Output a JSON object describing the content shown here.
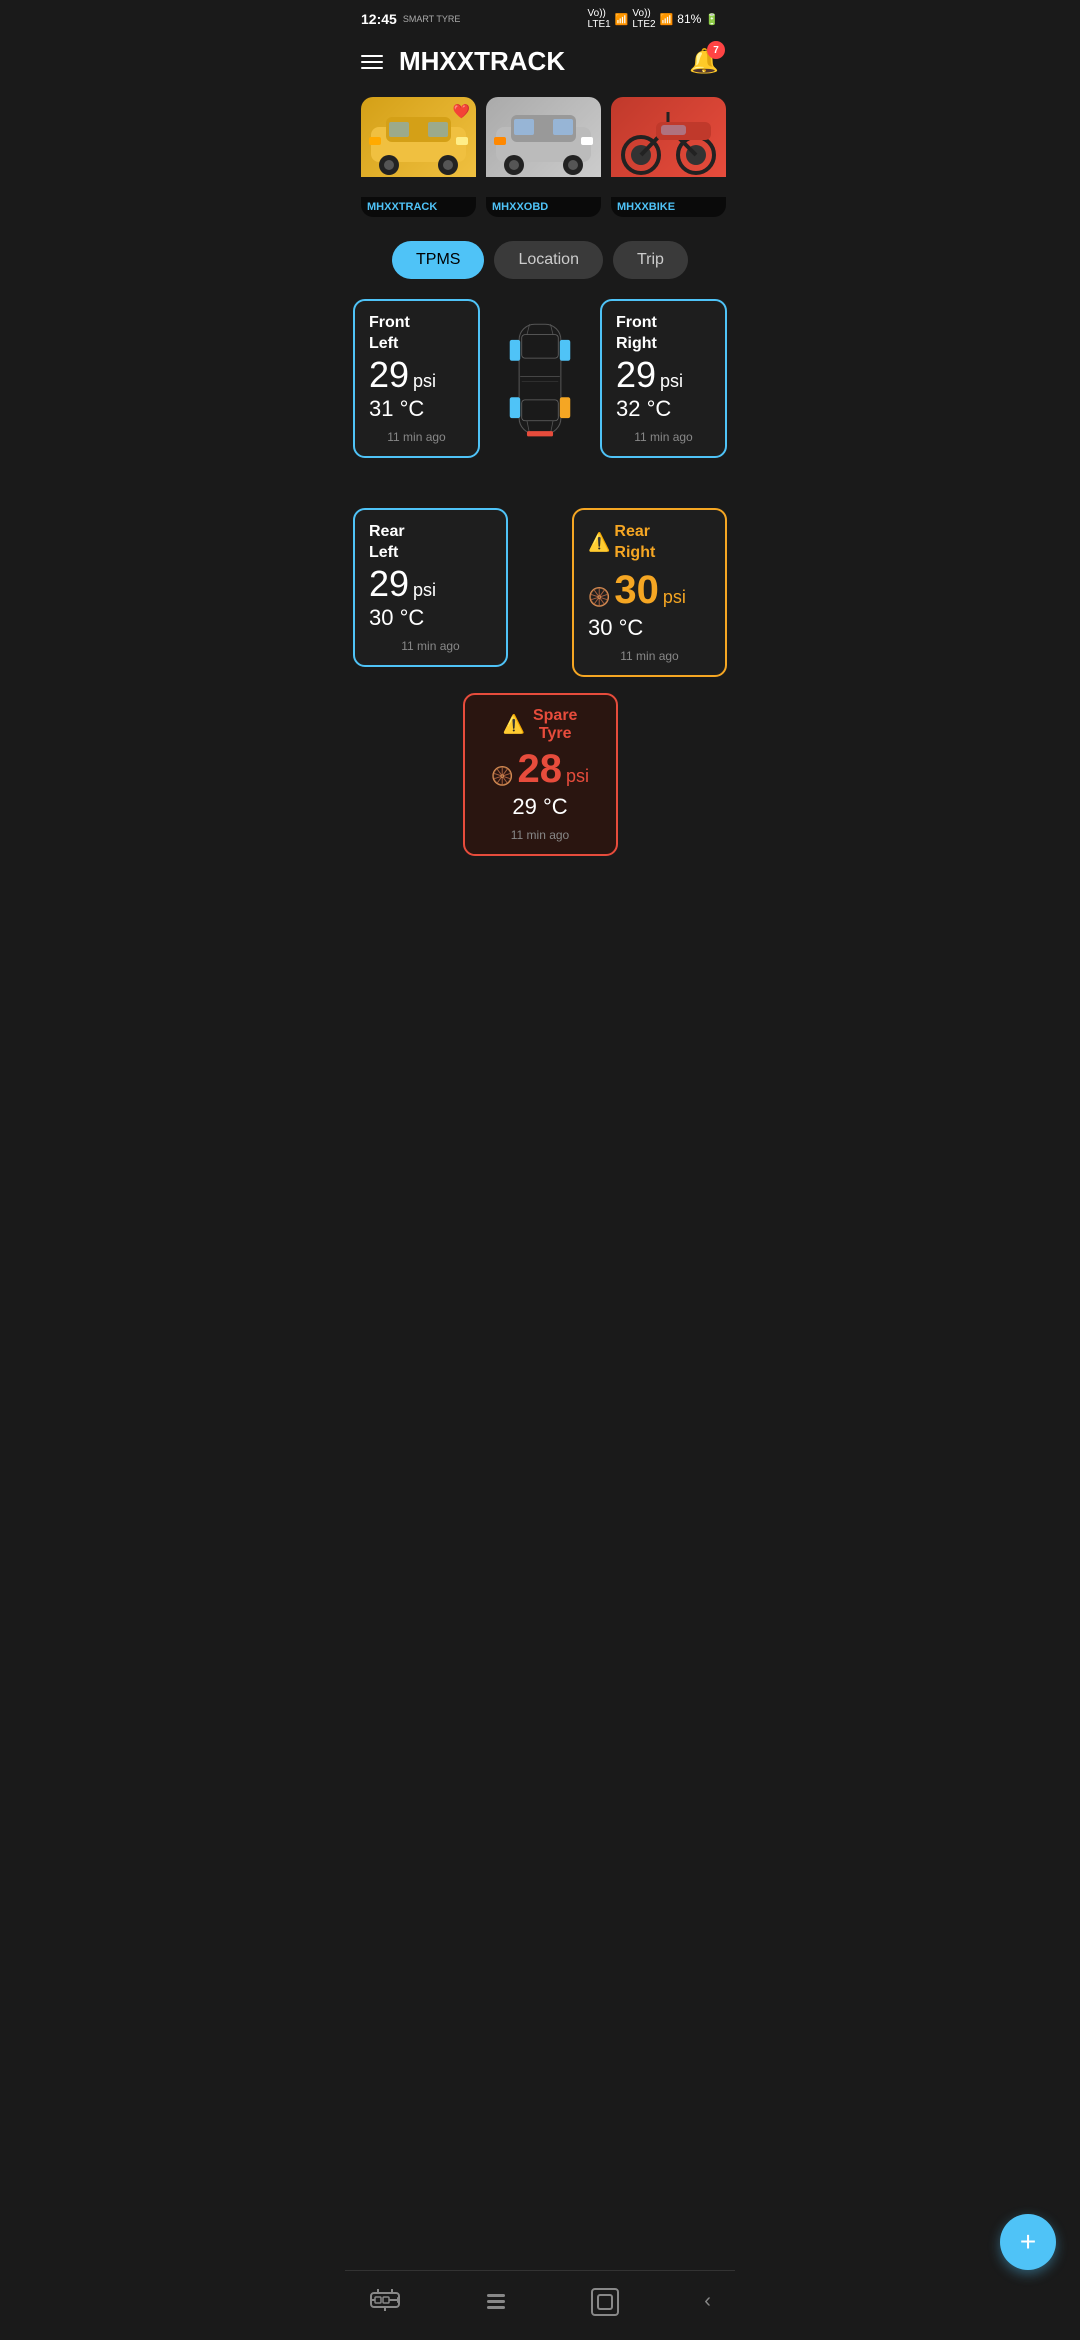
{
  "statusBar": {
    "time": "12:45",
    "smartTyre": "SMART TYRE",
    "signal1": "VoLTE1",
    "signal2": "VoLTE2",
    "lte": "LTE",
    "battery": "81%"
  },
  "header": {
    "title": "MHXXTRACK",
    "menuLabel": "menu",
    "notificationCount": "7"
  },
  "vehicles": [
    {
      "id": "v1",
      "name": "MHXXTRACK",
      "type": "car-yellow",
      "favorite": true
    },
    {
      "id": "v2",
      "name": "MHXXOBD",
      "type": "car-silver",
      "favorite": false
    },
    {
      "id": "v3",
      "name": "MHXXBIKE",
      "type": "bike-red",
      "favorite": false
    }
  ],
  "tabs": [
    {
      "id": "tpms",
      "label": "TPMS",
      "active": true
    },
    {
      "id": "location",
      "label": "Location",
      "active": false
    },
    {
      "id": "trip",
      "label": "Trip",
      "active": false
    }
  ],
  "tyres": {
    "frontLeft": {
      "name": "Front\nLeft",
      "pressure": "29",
      "unit": "psi",
      "temp": "31 °C",
      "time": "11 min ago",
      "status": "normal"
    },
    "frontRight": {
      "name": "Front\nRight",
      "pressure": "29",
      "unit": "psi",
      "temp": "32 °C",
      "time": "11 min ago",
      "status": "normal"
    },
    "rearLeft": {
      "name": "Rear\nLeft",
      "pressure": "29",
      "unit": "psi",
      "temp": "30 °C",
      "time": "11 min ago",
      "status": "normal"
    },
    "rearRight": {
      "name": "Rear\nRight",
      "pressure": "30",
      "unit": "psi",
      "temp": "30 °C",
      "time": "11 min ago",
      "status": "warning"
    },
    "spare": {
      "name": "Spare\nTyre",
      "pressure": "28",
      "unit": "psi",
      "temp": "29 °C",
      "time": "11 min ago",
      "status": "danger"
    }
  },
  "fab": {
    "label": "+"
  },
  "colors": {
    "accent": "#4fc3f7",
    "warning": "#f5a623",
    "danger": "#e74c3c",
    "normal": "#4fc3f7",
    "bg": "#1a1a1a",
    "card": "#1e1e1e"
  }
}
